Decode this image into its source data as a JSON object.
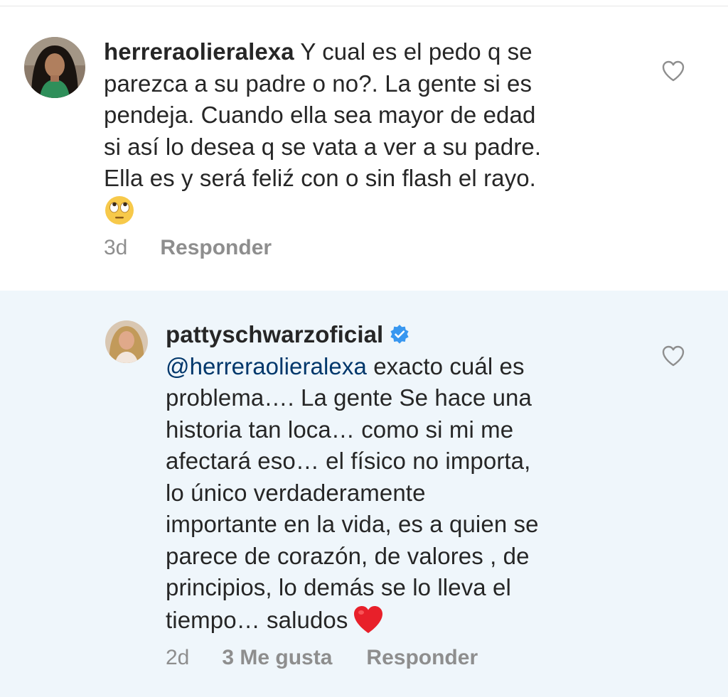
{
  "comments": [
    {
      "username": "herreraolieralexa",
      "lines": [
        "Y cual es el pedo q se",
        "parezca a su padre o no?. La gente si es",
        "pendeja. Cuando ella sea mayor de edad",
        "si así lo desea q se vata a ver a su padre.",
        "Ella es y será feliź con o sin flash el rayo."
      ],
      "trailing_emoji": "face-with-rolling-eyes-emoji",
      "time": "3d",
      "reply_label": "Responder"
    },
    {
      "username": "pattyschwarzoficial",
      "verified": true,
      "mention": "@herreraolieralexa",
      "lines": [
        "exacto cuál es",
        "problema…. La gente Se hace una",
        "historia tan  loca… como si mi me",
        "afectará eso… el físico no importa,",
        "lo único verdaderamente",
        "importante en la vida, es a quien se",
        "parece de corazón, de valores , de",
        "principios, lo demás se lo lleva el",
        "tiempo… saludos"
      ],
      "trailing_emoji": "red-heart-emoji",
      "time": "2d",
      "likes_label": "3 Me gusta",
      "reply_label": "Responder"
    }
  ],
  "colors": {
    "text": "#262626",
    "secondary": "#8e8e8e",
    "mention": "#00376b",
    "highlight_bg": "#eff6fb",
    "verified": "#3897f0",
    "heart_red": "#e0245e"
  },
  "icons": {
    "like": "heart-outline-icon",
    "verified": "verified-badge-icon"
  }
}
